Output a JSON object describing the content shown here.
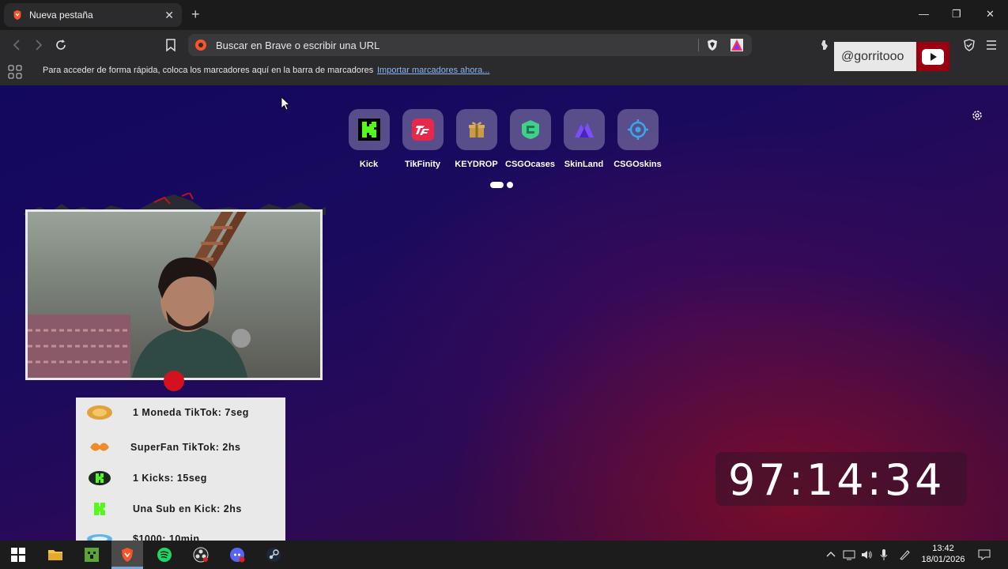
{
  "browser": {
    "tab": {
      "title": "Nueva pestaña",
      "favicon": "brave-lion-icon",
      "close_label": "✕"
    },
    "new_tab_label": "+",
    "window_controls": {
      "minimize": "—",
      "maximize": "❐",
      "close": "✕"
    },
    "omnibox": {
      "placeholder": "Buscar en Brave o escribir una URL"
    },
    "bookmarks_bar": {
      "hint": "Para acceder de forma rápida, coloca los marcadores aquí en la barra de marcadores",
      "import_link": "Importar marcadores ahora..."
    }
  },
  "top_sites": [
    {
      "label": "Kick",
      "icon": "kick-icon",
      "color": "#53fc18"
    },
    {
      "label": "TikFinity",
      "icon": "tikfinity-icon",
      "color": "#e8284a"
    },
    {
      "label": "KEYDROP",
      "icon": "keydrop-icon",
      "color": "#c89a4a"
    },
    {
      "label": "CSGOcases",
      "icon": "csgocases-icon",
      "color": "#3fd08a"
    },
    {
      "label": "SkinLand",
      "icon": "skinland-icon",
      "color": "#7b4dff"
    },
    {
      "label": "CSGOskins",
      "icon": "csgoskins-icon",
      "color": "#3aa8e8"
    }
  ],
  "overlay": {
    "youtube_handle": "@gorritooo",
    "rewards": [
      {
        "icon": "tiktok-coin-icon",
        "text": "1 Moneda TikTok: 7seg"
      },
      {
        "icon": "superfan-icon",
        "text": "SuperFan TikTok: 2hs"
      },
      {
        "icon": "kicks-icon",
        "text": "1 Kicks: 15seg"
      },
      {
        "icon": "kick-sub-icon",
        "text": "Una Sub en Kick: 2hs"
      },
      {
        "icon": "money-icon",
        "text": "$1000: 10min"
      }
    ],
    "timer": "97:14:34"
  },
  "taskbar": {
    "apps": [
      "windows-start-icon",
      "file-explorer-icon",
      "minecraft-icon",
      "brave-icon",
      "spotify-icon",
      "obs-icon",
      "discord-icon",
      "steam-icon"
    ],
    "time": "13:42",
    "date": "18/01/2026"
  }
}
